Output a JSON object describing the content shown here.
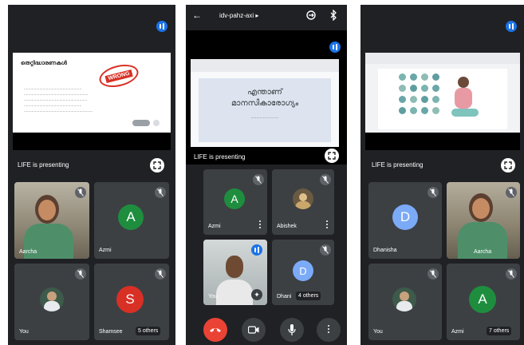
{
  "colors": {
    "bg": "#202124",
    "tile": "#3c4043",
    "blue": "#1a73e8",
    "green": "#1e8e3e",
    "red": "#ea4335",
    "orange": "#e8710a",
    "slate": "#8ab4f8"
  },
  "phone1": {
    "slide_title": "തെറ്റിദ്ധാരണകൾ",
    "stamp": "WRONG",
    "slide_lines": [
      "....................................................",
      "..........................................................",
      ".........................................................",
      "....................................................",
      ".............................................................."
    ],
    "presenting": "LIFE is presenting",
    "tiles": [
      {
        "name": "Aarcha"
      },
      {
        "name": "Azmi",
        "initial": "A"
      },
      {
        "name": "You"
      },
      {
        "name": "Shamsee",
        "initial": "S",
        "others": "5 others"
      }
    ]
  },
  "phone2": {
    "meeting_code": "idv-pahz-axi",
    "slide_title_1": "എന്താണ്",
    "slide_title_2": "മാനസികാരോഗ്യം",
    "slide_sub": ".........................",
    "presenting": "LIFE is presenting",
    "tiles": [
      {
        "name": "Azmi",
        "initial": "A"
      },
      {
        "name": "Abishek"
      },
      {
        "name": "You"
      },
      {
        "name": "Dhani",
        "initial": "D",
        "others": "4 others"
      }
    ]
  },
  "phone3": {
    "presenting": "LIFE is presenting",
    "tiles": [
      {
        "name": "Dhanisha",
        "initial": "D"
      },
      {
        "name": "Aarcha"
      },
      {
        "name": "You"
      },
      {
        "name": "Azmi",
        "initial": "A",
        "others": "7 others"
      }
    ]
  }
}
